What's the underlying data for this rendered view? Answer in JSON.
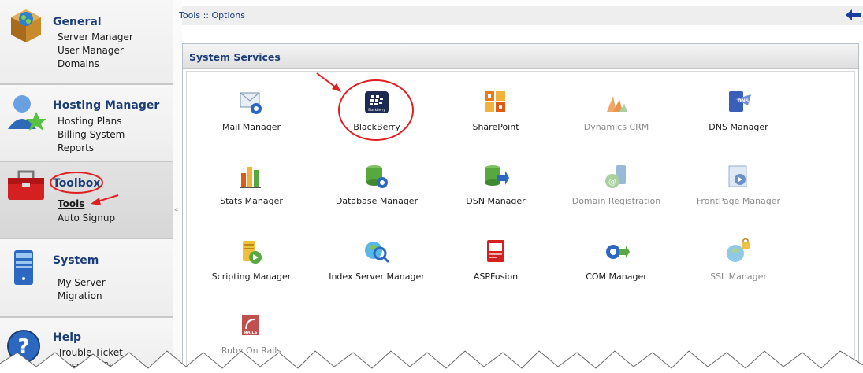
{
  "sidebar": {
    "sections": [
      {
        "title": "General",
        "items": [
          "Server Manager",
          "User Manager",
          "Domains"
        ]
      },
      {
        "title": "Hosting Manager",
        "items": [
          "Hosting Plans",
          "Billing System",
          "Reports"
        ]
      },
      {
        "title": "Toolbox",
        "items": [
          "Tools",
          "Auto Signup"
        ]
      },
      {
        "title": "System",
        "items": [
          "My Server",
          "Migration"
        ]
      },
      {
        "title": "Help",
        "items": [
          "Trouble Ticket",
          "Message Center"
        ]
      }
    ],
    "splitter_glyph": "«"
  },
  "topbar": {
    "breadcrumb": "Tools :: Options"
  },
  "panel": {
    "title": "System Services",
    "tiles": [
      {
        "label": "Mail Manager",
        "icon": "mail-icon"
      },
      {
        "label": "BlackBerry",
        "icon": "blackberry-icon"
      },
      {
        "label": "SharePoint",
        "icon": "sharepoint-icon"
      },
      {
        "label": "Dynamics CRM",
        "icon": "dynamics-crm-icon"
      },
      {
        "label": "DNS Manager",
        "icon": "dns-icon"
      },
      {
        "label": "Stats Manager",
        "icon": "stats-icon"
      },
      {
        "label": "Database Manager",
        "icon": "database-icon"
      },
      {
        "label": "DSN Manager",
        "icon": "dsn-icon"
      },
      {
        "label": "Domain Registration",
        "icon": "domain-registration-icon"
      },
      {
        "label": "FrontPage Manager",
        "icon": "frontpage-icon"
      },
      {
        "label": "Scripting Manager",
        "icon": "scripting-icon"
      },
      {
        "label": "Index Server Manager",
        "icon": "index-server-icon"
      },
      {
        "label": "ASPFusion",
        "icon": "aspfusion-icon"
      },
      {
        "label": "COM Manager",
        "icon": "com-icon"
      },
      {
        "label": "SSL Manager",
        "icon": "ssl-icon"
      },
      {
        "label": "Ruby On Rails",
        "icon": "ruby-on-rails-icon"
      }
    ]
  },
  "icon_text": {
    "dns": "DNS",
    "rails": "RAILS",
    "blackberry": "BlackBerry"
  },
  "colors": {
    "title_blue": "#1a3d78",
    "annotation_red": "#e02020",
    "disabled_text": "#8a8a8a"
  }
}
